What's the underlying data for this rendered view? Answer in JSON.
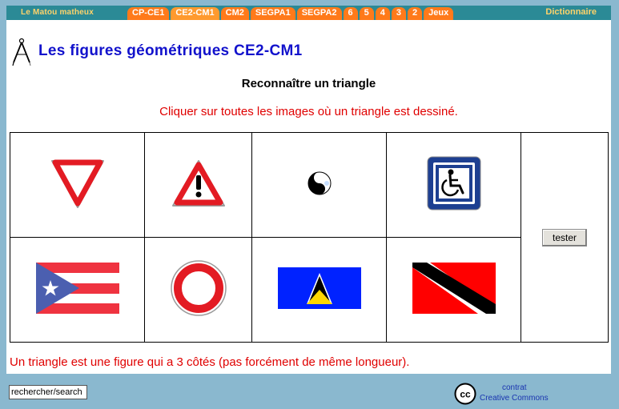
{
  "nav": {
    "brand": "Le Matou matheux",
    "tabs": [
      {
        "label": "CP-CE1"
      },
      {
        "label": "CE2-CM1"
      },
      {
        "label": "CM2"
      },
      {
        "label": "SEGPA1"
      },
      {
        "label": "SEGPA2"
      },
      {
        "label": "6"
      },
      {
        "label": "5"
      },
      {
        "label": "4"
      },
      {
        "label": "3"
      },
      {
        "label": "2"
      },
      {
        "label": "Jeux"
      }
    ],
    "dictionary": "Dictionnaire"
  },
  "header": {
    "title": "Les figures géométriques CE2-CM1",
    "icon": "compass-icon"
  },
  "exercise": {
    "subtitle": "Reconnaître un triangle",
    "instruction": "Cliquer sur toutes les images où un triangle est dessiné.",
    "images": [
      {
        "name": "yield-sign-image",
        "icon": "yield-sign-icon"
      },
      {
        "name": "warning-sign-image",
        "icon": "warning-sign-icon"
      },
      {
        "name": "yin-yang-image",
        "icon": "yin-yang-icon"
      },
      {
        "name": "handicap-sign-image",
        "icon": "wheelchair-icon"
      },
      {
        "name": "puerto-rico-flag-image",
        "icon": "puerto-rico-flag-icon"
      },
      {
        "name": "no-entry-sign-image",
        "icon": "no-vehicles-sign-icon"
      },
      {
        "name": "saint-lucia-flag-image",
        "icon": "saint-lucia-flag-icon"
      },
      {
        "name": "trinidad-flag-image",
        "icon": "trinidad-flag-icon"
      }
    ],
    "check_button": "tester",
    "definition": "Un triangle est une figure qui a 3 côtés (pas forcément de même longueur)."
  },
  "footer": {
    "search_value": "rechercher/search",
    "cc_line1": "contrat",
    "cc_line2": "Creative Commons"
  },
  "colors": {
    "background": "#8ab8cf",
    "nav_bar": "#2b8a96",
    "tab": "#ff7a1a",
    "brand_text": "#ffd36a",
    "title_blue": "#1212cc",
    "instruction_red": "#e00000"
  }
}
